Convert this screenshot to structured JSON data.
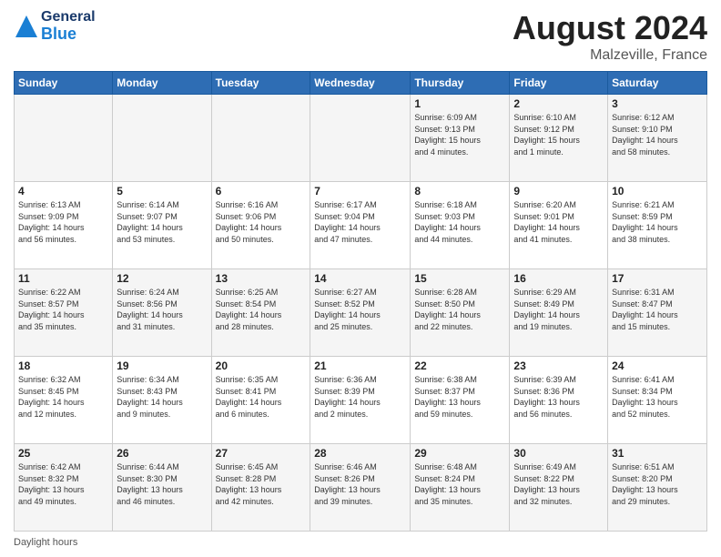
{
  "header": {
    "logo_general": "General",
    "logo_blue": "Blue",
    "month_title": "August 2024",
    "location": "Malzeville, France"
  },
  "footer": {
    "daylight_label": "Daylight hours"
  },
  "calendar": {
    "days_of_week": [
      "Sunday",
      "Monday",
      "Tuesday",
      "Wednesday",
      "Thursday",
      "Friday",
      "Saturday"
    ],
    "weeks": [
      [
        {
          "day": "",
          "info": ""
        },
        {
          "day": "",
          "info": ""
        },
        {
          "day": "",
          "info": ""
        },
        {
          "day": "",
          "info": ""
        },
        {
          "day": "1",
          "info": "Sunrise: 6:09 AM\nSunset: 9:13 PM\nDaylight: 15 hours\nand 4 minutes."
        },
        {
          "day": "2",
          "info": "Sunrise: 6:10 AM\nSunset: 9:12 PM\nDaylight: 15 hours\nand 1 minute."
        },
        {
          "day": "3",
          "info": "Sunrise: 6:12 AM\nSunset: 9:10 PM\nDaylight: 14 hours\nand 58 minutes."
        }
      ],
      [
        {
          "day": "4",
          "info": "Sunrise: 6:13 AM\nSunset: 9:09 PM\nDaylight: 14 hours\nand 56 minutes."
        },
        {
          "day": "5",
          "info": "Sunrise: 6:14 AM\nSunset: 9:07 PM\nDaylight: 14 hours\nand 53 minutes."
        },
        {
          "day": "6",
          "info": "Sunrise: 6:16 AM\nSunset: 9:06 PM\nDaylight: 14 hours\nand 50 minutes."
        },
        {
          "day": "7",
          "info": "Sunrise: 6:17 AM\nSunset: 9:04 PM\nDaylight: 14 hours\nand 47 minutes."
        },
        {
          "day": "8",
          "info": "Sunrise: 6:18 AM\nSunset: 9:03 PM\nDaylight: 14 hours\nand 44 minutes."
        },
        {
          "day": "9",
          "info": "Sunrise: 6:20 AM\nSunset: 9:01 PM\nDaylight: 14 hours\nand 41 minutes."
        },
        {
          "day": "10",
          "info": "Sunrise: 6:21 AM\nSunset: 8:59 PM\nDaylight: 14 hours\nand 38 minutes."
        }
      ],
      [
        {
          "day": "11",
          "info": "Sunrise: 6:22 AM\nSunset: 8:57 PM\nDaylight: 14 hours\nand 35 minutes."
        },
        {
          "day": "12",
          "info": "Sunrise: 6:24 AM\nSunset: 8:56 PM\nDaylight: 14 hours\nand 31 minutes."
        },
        {
          "day": "13",
          "info": "Sunrise: 6:25 AM\nSunset: 8:54 PM\nDaylight: 14 hours\nand 28 minutes."
        },
        {
          "day": "14",
          "info": "Sunrise: 6:27 AM\nSunset: 8:52 PM\nDaylight: 14 hours\nand 25 minutes."
        },
        {
          "day": "15",
          "info": "Sunrise: 6:28 AM\nSunset: 8:50 PM\nDaylight: 14 hours\nand 22 minutes."
        },
        {
          "day": "16",
          "info": "Sunrise: 6:29 AM\nSunset: 8:49 PM\nDaylight: 14 hours\nand 19 minutes."
        },
        {
          "day": "17",
          "info": "Sunrise: 6:31 AM\nSunset: 8:47 PM\nDaylight: 14 hours\nand 15 minutes."
        }
      ],
      [
        {
          "day": "18",
          "info": "Sunrise: 6:32 AM\nSunset: 8:45 PM\nDaylight: 14 hours\nand 12 minutes."
        },
        {
          "day": "19",
          "info": "Sunrise: 6:34 AM\nSunset: 8:43 PM\nDaylight: 14 hours\nand 9 minutes."
        },
        {
          "day": "20",
          "info": "Sunrise: 6:35 AM\nSunset: 8:41 PM\nDaylight: 14 hours\nand 6 minutes."
        },
        {
          "day": "21",
          "info": "Sunrise: 6:36 AM\nSunset: 8:39 PM\nDaylight: 14 hours\nand 2 minutes."
        },
        {
          "day": "22",
          "info": "Sunrise: 6:38 AM\nSunset: 8:37 PM\nDaylight: 13 hours\nand 59 minutes."
        },
        {
          "day": "23",
          "info": "Sunrise: 6:39 AM\nSunset: 8:36 PM\nDaylight: 13 hours\nand 56 minutes."
        },
        {
          "day": "24",
          "info": "Sunrise: 6:41 AM\nSunset: 8:34 PM\nDaylight: 13 hours\nand 52 minutes."
        }
      ],
      [
        {
          "day": "25",
          "info": "Sunrise: 6:42 AM\nSunset: 8:32 PM\nDaylight: 13 hours\nand 49 minutes."
        },
        {
          "day": "26",
          "info": "Sunrise: 6:44 AM\nSunset: 8:30 PM\nDaylight: 13 hours\nand 46 minutes."
        },
        {
          "day": "27",
          "info": "Sunrise: 6:45 AM\nSunset: 8:28 PM\nDaylight: 13 hours\nand 42 minutes."
        },
        {
          "day": "28",
          "info": "Sunrise: 6:46 AM\nSunset: 8:26 PM\nDaylight: 13 hours\nand 39 minutes."
        },
        {
          "day": "29",
          "info": "Sunrise: 6:48 AM\nSunset: 8:24 PM\nDaylight: 13 hours\nand 35 minutes."
        },
        {
          "day": "30",
          "info": "Sunrise: 6:49 AM\nSunset: 8:22 PM\nDaylight: 13 hours\nand 32 minutes."
        },
        {
          "day": "31",
          "info": "Sunrise: 6:51 AM\nSunset: 8:20 PM\nDaylight: 13 hours\nand 29 minutes."
        }
      ]
    ]
  }
}
